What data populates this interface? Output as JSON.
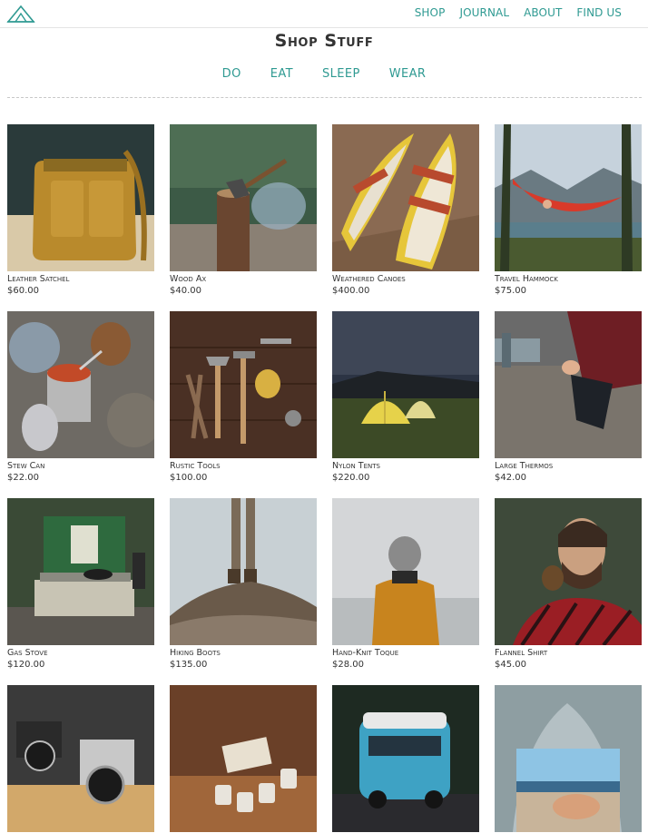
{
  "nav": {
    "items": [
      "SHOP",
      "JOURNAL",
      "ABOUT",
      "FIND US"
    ]
  },
  "page": {
    "title": "Shop Stuff"
  },
  "categories": [
    "DO",
    "EAT",
    "SLEEP",
    "WEAR"
  ],
  "products": [
    {
      "name": "Leather Satchel",
      "price": "$60.00",
      "image": "leather-satchel-image"
    },
    {
      "name": "Wood Ax",
      "price": "$40.00",
      "image": "wood-ax-image"
    },
    {
      "name": "Weathered Canoes",
      "price": "$400.00",
      "image": "canoes-image"
    },
    {
      "name": "Travel Hammock",
      "price": "$75.00",
      "image": "hammock-image"
    },
    {
      "name": "Stew Can",
      "price": "$22.00",
      "image": "stew-can-image"
    },
    {
      "name": "Rustic Tools",
      "price": "$100.00",
      "image": "rustic-tools-image"
    },
    {
      "name": "Nylon Tents",
      "price": "$220.00",
      "image": "tents-image"
    },
    {
      "name": "Large Thermos",
      "price": "$42.00",
      "image": "thermos-image"
    },
    {
      "name": "Gas Stove",
      "price": "$120.00",
      "image": "gas-stove-image"
    },
    {
      "name": "Hiking Boots",
      "price": "$135.00",
      "image": "hiking-boots-image"
    },
    {
      "name": "Hand-Knit Toque",
      "price": "$28.00",
      "image": "toque-image"
    },
    {
      "name": "Flannel Shirt",
      "price": "$45.00",
      "image": "flannel-shirt-image"
    },
    {
      "name": "",
      "price": "",
      "image": "cameras-image"
    },
    {
      "name": "",
      "price": "",
      "image": "mugs-image"
    },
    {
      "name": "",
      "price": "",
      "image": "camper-van-image"
    },
    {
      "name": "",
      "price": "",
      "image": "tent-view-image"
    }
  ]
}
